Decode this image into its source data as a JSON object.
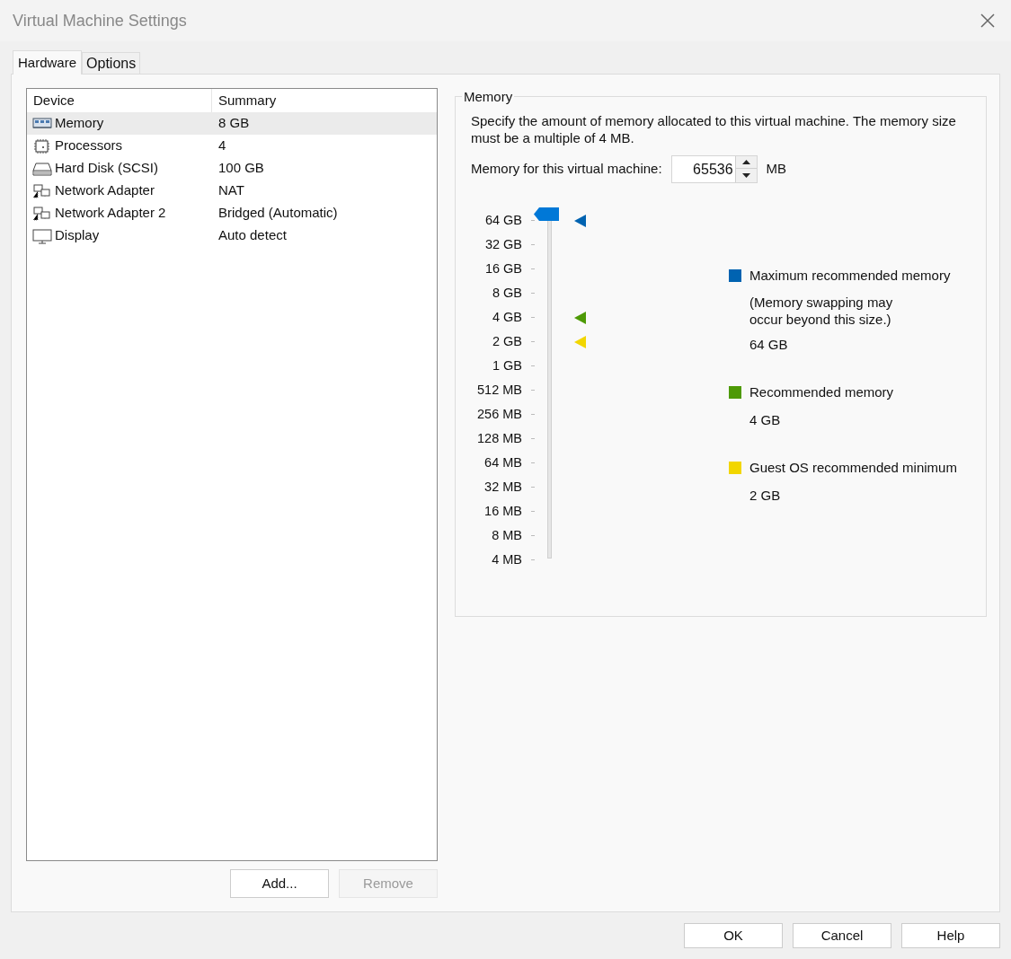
{
  "window": {
    "title": "Virtual Machine Settings"
  },
  "tabs": [
    {
      "label": "Hardware",
      "selected": true
    },
    {
      "label": "Options",
      "selected": false
    }
  ],
  "device_table": {
    "columns": [
      "Device",
      "Summary"
    ],
    "rows": [
      {
        "kind": "memory",
        "device": "Memory",
        "summary": "8 GB",
        "selected": true
      },
      {
        "kind": "processor",
        "device": "Processors",
        "summary": "4",
        "selected": false
      },
      {
        "kind": "disk",
        "device": "Hard Disk (SCSI)",
        "summary": "100 GB",
        "selected": false
      },
      {
        "kind": "network",
        "device": "Network Adapter",
        "summary": "NAT",
        "selected": false
      },
      {
        "kind": "network",
        "device": "Network Adapter 2",
        "summary": "Bridged (Automatic)",
        "selected": false
      },
      {
        "kind": "display",
        "device": "Display",
        "summary": "Auto detect",
        "selected": false
      }
    ]
  },
  "device_buttons": [
    {
      "label": "Add...",
      "disabled": false
    },
    {
      "label": "Remove",
      "disabled": true
    }
  ],
  "memory_panel": {
    "title": "Memory",
    "description": "Specify the amount of memory allocated to this virtual machine. The memory size must be a multiple of 4 MB.",
    "field_label": "Memory for this virtual machine:",
    "value": "65536",
    "unit": "MB",
    "slider": {
      "level": 1,
      "ticks": [
        {
          "label": "64 GB",
          "color": "#0063b1"
        },
        {
          "label": "32 GB"
        },
        {
          "label": "16 GB"
        },
        {
          "label": "8 GB"
        },
        {
          "label": "4 GB",
          "color": "#4e9a06"
        },
        {
          "label": "2 GB",
          "color": "#f2d600"
        },
        {
          "label": "1 GB"
        },
        {
          "label": "512 MB"
        },
        {
          "label": "256 MB"
        },
        {
          "label": "128 MB"
        },
        {
          "label": "64 MB"
        },
        {
          "label": "32 MB"
        },
        {
          "label": "16 MB"
        },
        {
          "label": "8 MB"
        },
        {
          "label": "4 MB"
        }
      ]
    },
    "legend": [
      {
        "color": "#0063b1",
        "title": "Maximum recommended memory",
        "note": "(Memory swapping may occur beyond this size.)",
        "value": "64 GB"
      },
      {
        "color": "#4e9a06",
        "title": "Recommended memory",
        "value": "4 GB"
      },
      {
        "color": "#f2d600",
        "title": "Guest OS recommended minimum",
        "value": "2 GB"
      }
    ]
  },
  "dialog_buttons": [
    "OK",
    "Cancel",
    "Help"
  ]
}
